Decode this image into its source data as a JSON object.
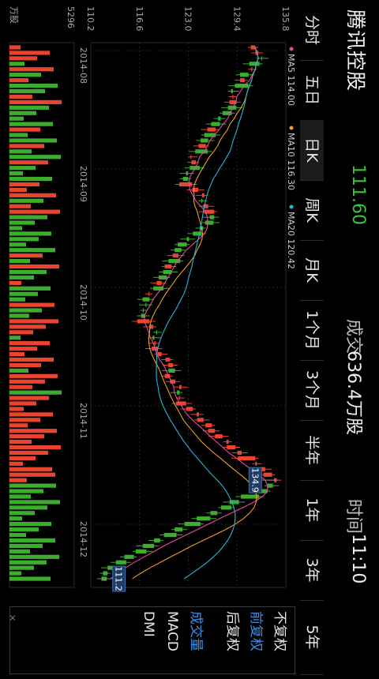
{
  "header": {
    "stock_name": "腾讯控股",
    "price": "111.60",
    "volume_label": "成交",
    "volume": "636.4万股",
    "time_label": "时间",
    "time": "11:10"
  },
  "tabs": [
    {
      "label": "分时",
      "active": false
    },
    {
      "label": "五日",
      "active": false
    },
    {
      "label": "日K",
      "active": true
    },
    {
      "label": "周K",
      "active": false
    },
    {
      "label": "月K",
      "active": false
    },
    {
      "label": "1个月",
      "active": false
    },
    {
      "label": "3个月",
      "active": false
    },
    {
      "label": "半年",
      "active": false
    },
    {
      "label": "1年",
      "active": false
    },
    {
      "label": "3年",
      "active": false
    },
    {
      "label": "5年",
      "active": false
    }
  ],
  "side_menu": [
    {
      "label": "不复权",
      "color": "#e6e6e6"
    },
    {
      "label": "前复权",
      "color": "#3f8fe0"
    },
    {
      "label": "后复权",
      "color": "#e6e6e6"
    },
    {
      "label": "成交量",
      "color": "#3f8fe0"
    },
    {
      "label": "MACD",
      "color": "#e6e6e6"
    },
    {
      "label": "DMI",
      "color": "#e6e6e6"
    }
  ],
  "colors": {
    "up": "#e8442f",
    "down": "#3cad2f",
    "ma5": "#e84aa0",
    "ma10": "#f0a020",
    "ma20": "#27b5d8",
    "marker_bg": "#1d3d66"
  },
  "chart_data": {
    "type": "candlestick",
    "y_ticks": [
      "135.8",
      "129.4",
      "123.0",
      "116.6",
      "110.2"
    ],
    "ylim": [
      110.2,
      135.8
    ],
    "x_labels": [
      "2014-08",
      "2014-09",
      "2014-10",
      "2014-11",
      "2014-12"
    ],
    "ma_legend": [
      {
        "name": "MA5",
        "value": "114.00"
      },
      {
        "name": "MA10",
        "value": "116.30"
      },
      {
        "name": "MA20",
        "value": "120.42"
      }
    ],
    "high_marker": "134.9",
    "low_marker": "111.2",
    "volume_axis": [
      "5296",
      "万股"
    ],
    "closes": [
      131.8,
      132.2,
      132.6,
      131.0,
      131.4,
      129.8,
      130.4,
      129.1,
      128.6,
      128.9,
      129.3,
      128.2,
      127.5,
      126.9,
      126.0,
      126.6,
      125.1,
      124.6,
      125.3,
      123.9,
      123.4,
      124.0,
      123.2,
      122.7,
      122.3,
      123.5,
      124.3,
      125.1,
      124.7,
      125.6,
      126.4,
      125.8,
      125.2,
      124.5,
      123.6,
      122.8,
      121.6,
      121.2,
      121.7,
      120.4,
      120.8,
      119.7,
      119.1,
      119.5,
      118.4,
      117.9,
      117.0,
      117.4,
      117.1,
      116.8,
      117.9,
      118.4,
      118.8,
      118.3,
      118.7,
      119.0,
      119.5,
      120.6,
      121.0,
      120.4,
      120.6,
      121.3,
      122.1,
      121.5,
      121.9,
      122.7,
      123.6,
      124.4,
      125.0,
      126.1,
      126.5,
      127.5,
      128.3,
      129.2,
      130.0,
      131.8,
      132.0,
      133.1,
      134.0,
      134.6,
      133.4,
      131.8,
      129.9,
      128.4,
      127.3,
      125.9,
      124.1,
      122.5,
      121.2,
      119.8,
      118.5,
      117.0,
      116.1,
      114.6,
      113.5,
      112.4,
      111.8,
      111.6
    ]
  }
}
